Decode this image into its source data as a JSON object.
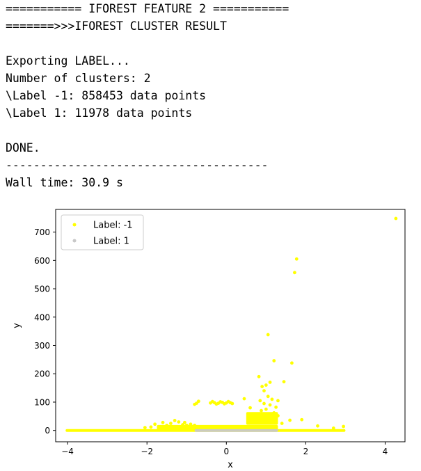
{
  "console": {
    "lines": [
      "=========== IFOREST FEATURE 2 ===========",
      "=======>>>IFOREST CLUSTER RESULT",
      "",
      "Exporting LABEL...",
      "Number of clusters: 2",
      "\\Label -1: 858453 data points",
      "\\Label 1: 11978 data points",
      "",
      "DONE.",
      "--------------------------------------",
      "Wall time: 30.9 s"
    ]
  },
  "chart_data": {
    "type": "scatter",
    "title": "",
    "xlabel": "x",
    "ylabel": "y",
    "xlim": [
      -4.3,
      4.5
    ],
    "ylim": [
      -40,
      780
    ],
    "xticks": [
      -4,
      -2,
      0,
      2,
      4
    ],
    "xtick_labels": [
      "−4",
      "−2",
      "0",
      "2",
      "4"
    ],
    "yticks": [
      0,
      100,
      200,
      300,
      400,
      500,
      600,
      700
    ],
    "ytick_labels": [
      "0",
      "100",
      "200",
      "300",
      "400",
      "500",
      "600",
      "700"
    ],
    "grid": false,
    "legend_position": "top-left",
    "series": [
      {
        "name": "Label: -1",
        "color": "#ffff00",
        "points": [
          [
            4.27,
            748
          ],
          [
            1.77,
            605
          ],
          [
            1.72,
            557
          ],
          [
            1.05,
            338
          ],
          [
            1.65,
            238
          ],
          [
            1.2,
            246
          ],
          [
            1.45,
            172
          ],
          [
            0.82,
            190
          ],
          [
            0.9,
            155
          ],
          [
            1.0,
            160
          ],
          [
            1.1,
            170
          ],
          [
            0.95,
            140
          ],
          [
            1.05,
            120
          ],
          [
            0.85,
            105
          ],
          [
            1.15,
            110
          ],
          [
            1.3,
            105
          ],
          [
            0.95,
            95
          ],
          [
            1.1,
            90
          ],
          [
            1.25,
            82
          ],
          [
            0.88,
            70
          ],
          [
            1.0,
            75
          ],
          [
            1.2,
            62
          ],
          [
            0.65,
            55
          ],
          [
            0.9,
            50
          ],
          [
            1.05,
            45
          ],
          [
            0.7,
            40
          ],
          [
            1.3,
            52
          ],
          [
            1.6,
            36
          ],
          [
            1.9,
            38
          ],
          [
            2.3,
            16
          ],
          [
            0.45,
            112
          ],
          [
            0.6,
            80
          ],
          [
            0.75,
            30
          ],
          [
            1.4,
            25
          ],
          [
            -0.75,
            96
          ],
          [
            -0.7,
            103
          ],
          [
            -0.8,
            92
          ],
          [
            -0.4,
            97
          ],
          [
            -0.3,
            98
          ],
          [
            -0.2,
            96
          ],
          [
            -0.1,
            99
          ],
          [
            0.0,
            97
          ],
          [
            0.1,
            98
          ],
          [
            -0.25,
            93
          ],
          [
            0.05,
            102
          ],
          [
            -0.15,
            101
          ],
          [
            -0.35,
            102
          ],
          [
            -0.05,
            94
          ],
          [
            0.15,
            95
          ],
          [
            -1.2,
            30
          ],
          [
            -1.4,
            25
          ],
          [
            -1.6,
            28
          ],
          [
            -1.8,
            22
          ],
          [
            -1.3,
            35
          ],
          [
            -1.05,
            28
          ],
          [
            -0.9,
            22
          ],
          [
            -1.5,
            18
          ],
          [
            -0.8,
            18
          ],
          [
            -1.1,
            20
          ],
          [
            -1.9,
            12
          ],
          [
            -0.6,
            12
          ],
          [
            -2.05,
            10
          ],
          [
            -0.35,
            8
          ],
          [
            2.95,
            14
          ],
          [
            2.7,
            8
          ],
          [
            -1.0,
            18
          ]
        ],
        "bands": [
          [
            -4.05,
            3.0,
            0,
            8
          ],
          [
            -1.75,
            1.3,
            8,
            24
          ],
          [
            0.5,
            1.3,
            25,
            70
          ]
        ]
      },
      {
        "name": "Label: 1",
        "color": "#c8c8c8",
        "points": [],
        "bands": [
          [
            -0.8,
            1.3,
            0,
            6
          ]
        ]
      }
    ]
  }
}
